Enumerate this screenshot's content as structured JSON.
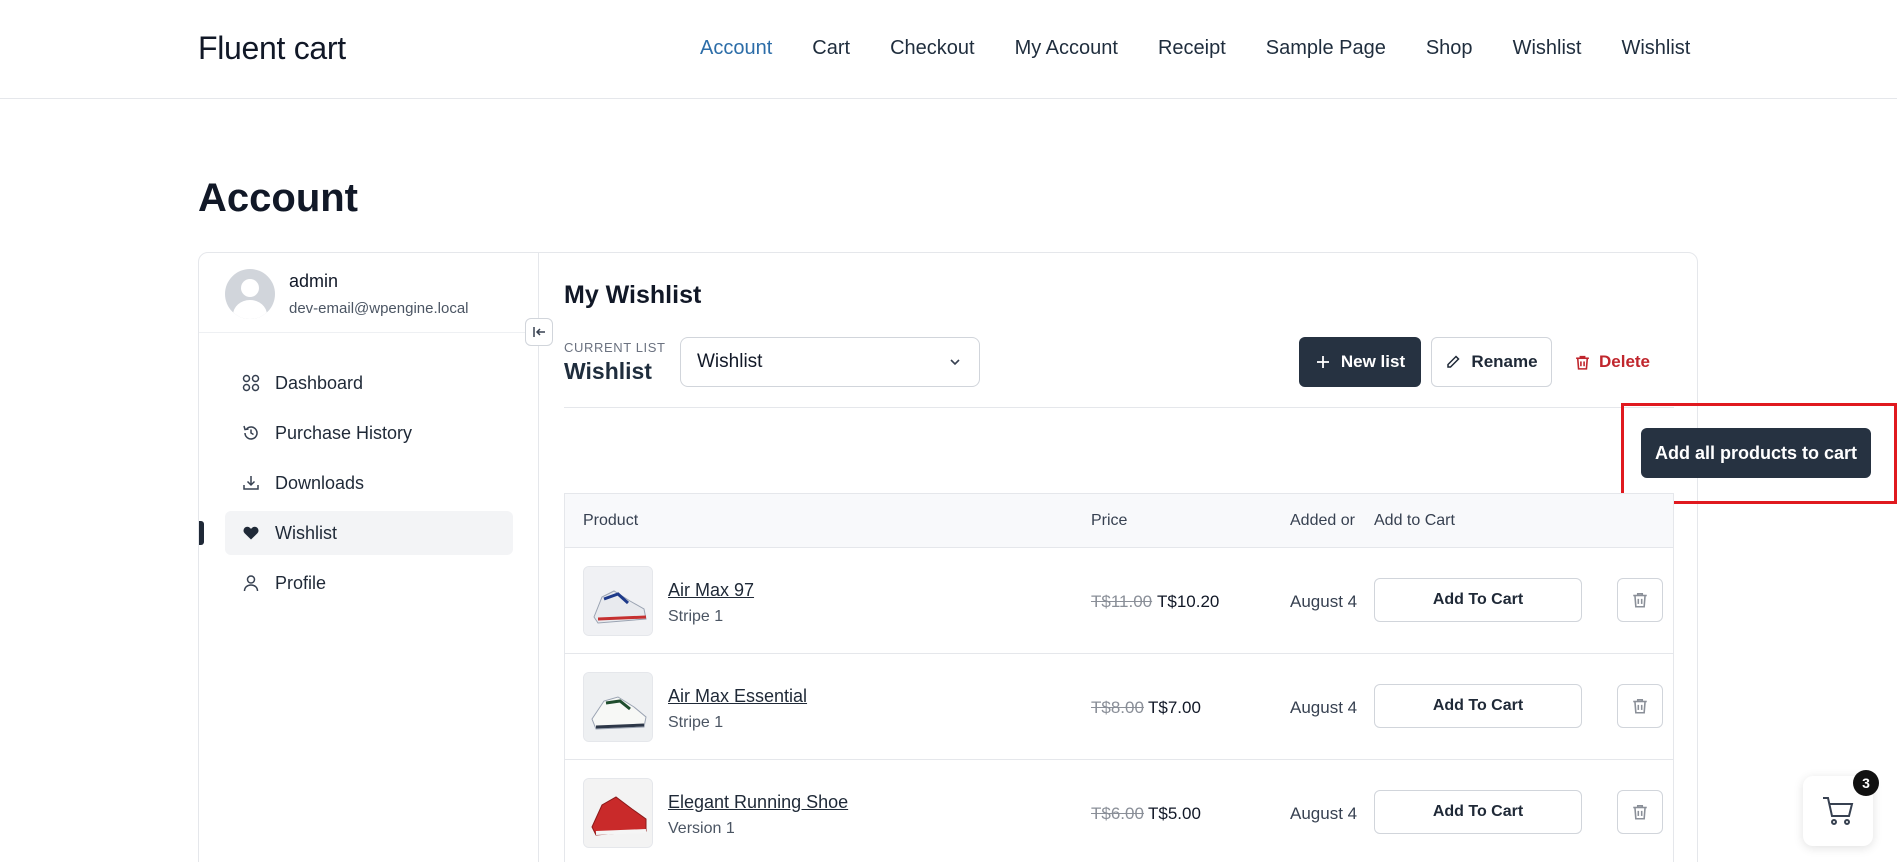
{
  "site": {
    "logo": "Fluent cart",
    "nav": [
      "Account",
      "Cart",
      "Checkout",
      "My Account",
      "Receipt",
      "Sample Page",
      "Shop",
      "Wishlist",
      "Wishlist"
    ],
    "active_nav": "Account"
  },
  "page_title": "Account",
  "user": {
    "name": "admin",
    "email": "dev-email@wpengine.local"
  },
  "sidebar": {
    "items": [
      {
        "label": "Dashboard",
        "icon": "dashboard-icon"
      },
      {
        "label": "Purchase History",
        "icon": "history-icon"
      },
      {
        "label": "Downloads",
        "icon": "download-icon"
      },
      {
        "label": "Wishlist",
        "icon": "heart-icon"
      },
      {
        "label": "Profile",
        "icon": "user-icon"
      }
    ],
    "active": "Wishlist"
  },
  "wishlist": {
    "title": "My Wishlist",
    "current_list_label": "CURRENT LIST",
    "current_list_name": "Wishlist",
    "select_value": "Wishlist",
    "new_list_label": "New list",
    "rename_label": "Rename",
    "delete_label": "Delete",
    "add_all_label": "Add all products to cart"
  },
  "table": {
    "headers": {
      "product": "Product",
      "price": "Price",
      "added": "Added or",
      "add_to_cart": "Add to Cart"
    },
    "rows": [
      {
        "name": "Air Max 97",
        "variant": "Stripe 1",
        "old_price": "T$11.00",
        "new_price": "T$10.20",
        "added": "August 4",
        "button": "Add To Cart"
      },
      {
        "name": "Air Max Essential",
        "variant": "Stripe 1",
        "old_price": "T$8.00",
        "new_price": "T$7.00",
        "added": "August 4",
        "button": "Add To Cart"
      },
      {
        "name": "Elegant Running Shoe",
        "variant": "Version 1",
        "old_price": "T$6.00",
        "new_price": "T$5.00",
        "added": "August 4",
        "button": "Add To Cart"
      }
    ]
  },
  "cart": {
    "count": "3"
  },
  "colors": {
    "dark_button": "#263241",
    "accent_link": "#2c6da8",
    "danger": "#c0262d",
    "highlight": "#e0191f"
  }
}
